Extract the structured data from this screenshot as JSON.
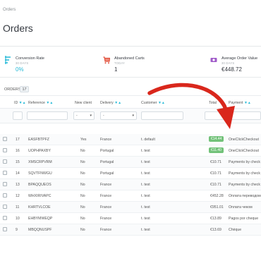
{
  "header": {
    "breadcrumb": "Orders",
    "title": "Orders"
  },
  "kpis": [
    {
      "label": "Conversion Rate",
      "sub": "30 DAYS",
      "value": "0%",
      "color": "#25b9d7",
      "icon": "funnel-icon"
    },
    {
      "label": "Abandoned Carts",
      "sub": "TODAY",
      "value": "1",
      "color": "#363a41",
      "icon": "cart-icon"
    },
    {
      "label": "Average Order Value",
      "sub": "30 DAYS",
      "value": "€448.72",
      "color": "#363a41",
      "icon": "money-icon"
    }
  ],
  "panel": {
    "title": "ORDERS",
    "count": "17"
  },
  "columns": {
    "id": "ID",
    "reference": "Reference",
    "new_client": "New client",
    "delivery": "Delivery",
    "customer": "Customer",
    "total": "Total",
    "payment": "Payment"
  },
  "filters": {
    "new_client_option": "-",
    "delivery_option": "-"
  },
  "rows": [
    {
      "id": "17",
      "reference": "EASFBTPFZ",
      "new_client": "Yes",
      "delivery": "France",
      "customer": "t. default",
      "total": "€14.44",
      "total_badge": true,
      "payment": "OneClickCheckout"
    },
    {
      "id": "16",
      "reference": "UOPHPAXBY",
      "new_client": "No",
      "delivery": "Portugal",
      "customer": "t. test",
      "total": "€11.40",
      "total_badge": true,
      "payment": "OneClickCheckout"
    },
    {
      "id": "15",
      "reference": "XMSCRPVRM",
      "new_client": "No",
      "delivery": "Portugal",
      "customer": "t. test",
      "total": "€10.71",
      "total_badge": false,
      "payment": "Payments by check"
    },
    {
      "id": "14",
      "reference": "SQVTFNWGU",
      "new_client": "No",
      "delivery": "Portugal",
      "customer": "t. test",
      "total": "€10.71",
      "total_badge": false,
      "payment": "Payments by check"
    },
    {
      "id": "13",
      "reference": "BPAQQUEOS",
      "new_client": "No",
      "delivery": "France",
      "customer": "t. test",
      "total": "€10.71",
      "total_badge": false,
      "payment": "Payments by check"
    },
    {
      "id": "12",
      "reference": "WHXIRIVAPC",
      "new_client": "No",
      "delivery": "France",
      "customer": "t. test",
      "total": "€452.28",
      "total_badge": false,
      "payment": "Оплата переводом"
    },
    {
      "id": "11",
      "reference": "KHRTVLCOE",
      "new_client": "No",
      "delivery": "France",
      "customer": "t. test",
      "total": "€951.01",
      "total_badge": false,
      "payment": "Оплата чеком"
    },
    {
      "id": "10",
      "reference": "EHBYMWEQP",
      "new_client": "No",
      "delivery": "France",
      "customer": "t. test",
      "total": "€13.89",
      "total_badge": false,
      "payment": "Pagos por cheque"
    },
    {
      "id": "9",
      "reference": "MBQQNUSPF",
      "new_client": "No",
      "delivery": "France",
      "customer": "t. test",
      "total": "€13.69",
      "total_badge": false,
      "payment": "Chèque"
    }
  ],
  "colors": {
    "accent": "#25b9d7",
    "badge_green": "#72c279",
    "arrow_red": "#d9271c"
  }
}
